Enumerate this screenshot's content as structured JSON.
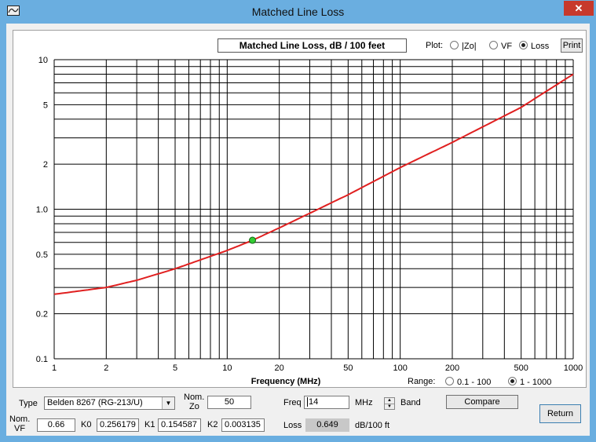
{
  "window": {
    "title": "Matched Line Loss",
    "close_label": "✕"
  },
  "plot": {
    "title": "Matched Line Loss, dB / 100 feet",
    "plot_label": "Plot:",
    "plot_options": [
      {
        "label": "|Zo|",
        "selected": false
      },
      {
        "label": "VF",
        "selected": false
      },
      {
        "label": "Loss",
        "selected": true
      }
    ],
    "print_label": "Print",
    "range_label": "Range:",
    "range_options": [
      {
        "label": "0.1 - 100",
        "selected": false
      },
      {
        "label": "1 - 1000",
        "selected": true
      }
    ],
    "marker": {
      "freq": 14,
      "loss": 0.649
    }
  },
  "chart_data": {
    "type": "line",
    "title": "Matched Line Loss, dB / 100 feet",
    "xlabel": "Frequency (MHz)",
    "ylabel": "",
    "x_scale": "log",
    "y_scale": "log",
    "xlim": [
      1,
      1000
    ],
    "ylim": [
      0.1,
      10
    ],
    "grid": true,
    "x_ticks": [
      "1",
      "2",
      "5",
      "10",
      "20",
      "50",
      "100",
      "200",
      "500",
      "1000"
    ],
    "y_ticks": [
      "10",
      "5",
      "2",
      "1.0",
      "0.5",
      "0.2",
      "0.1"
    ],
    "line_color": "#e02020",
    "marker_color": "#33cc33",
    "series": [
      {
        "x": [
          1,
          2,
          3,
          5,
          10,
          14,
          20,
          50,
          100,
          200,
          500,
          1000
        ],
        "y": [
          0.27,
          0.3,
          0.335,
          0.4,
          0.53,
          0.62,
          0.75,
          1.25,
          1.9,
          2.8,
          4.8,
          8.0
        ]
      }
    ]
  },
  "controls": {
    "type_label": "Type",
    "type_value": "Belden 8267   (RG-213/U)",
    "nom_zo_label_1": "Nom.",
    "nom_zo_label_2": "Zo",
    "nom_zo_value": "50",
    "freq_label": "Freq",
    "freq_value": "14",
    "freq_unit": "MHz",
    "band_label": "Band",
    "compare_label": "Compare",
    "return_label": "Return",
    "nom_vf_label_1": "Nom.",
    "nom_vf_label_2": "VF",
    "nom_vf_value": "0.66",
    "k0_label": "K0",
    "k0_value": "0.256179",
    "k1_label": "K1",
    "k1_value": "0.154587",
    "k2_label": "K2",
    "k2_value": "0.003135",
    "loss_label": "Loss",
    "loss_value": "0.649",
    "loss_unit": "dB/100 ft"
  }
}
